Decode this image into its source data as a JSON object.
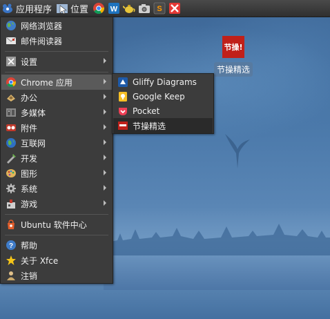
{
  "panel": {
    "apps_label": "应用程序",
    "places_label": "位置",
    "launchers": [
      "chrome-icon",
      "wps-writer-icon",
      "teapot-icon",
      "camera-icon",
      "sublime-text-icon",
      "xmind-icon"
    ]
  },
  "main_menu": {
    "items": [
      {
        "label": "网络浏览器",
        "icon": "web-browser-icon"
      },
      {
        "label": "邮件阅读器",
        "icon": "mail-reader-icon"
      },
      {
        "label": "设置",
        "icon": "settings-icon"
      },
      {
        "label": "Chrome 应用",
        "icon": "chrome-icon"
      },
      {
        "label": "办公",
        "icon": "office-icon"
      },
      {
        "label": "多媒体",
        "icon": "multimedia-icon"
      },
      {
        "label": "附件",
        "icon": "accessories-icon"
      },
      {
        "label": "互联网",
        "icon": "internet-icon"
      },
      {
        "label": "开发",
        "icon": "development-icon"
      },
      {
        "label": "图形",
        "icon": "graphics-icon"
      },
      {
        "label": "系统",
        "icon": "system-icon"
      },
      {
        "label": "游戏",
        "icon": "games-icon"
      },
      {
        "label": "Ubuntu 软件中心",
        "icon": "ubuntu-software-center-icon"
      },
      {
        "label": "帮助",
        "icon": "help-icon"
      },
      {
        "label": "关于 Xfce",
        "icon": "about-xfce-icon"
      },
      {
        "label": "注销",
        "icon": "logout-icon"
      }
    ]
  },
  "chrome_apps_menu": {
    "items": [
      {
        "label": "Gliffy Diagrams",
        "icon": "gliffy-icon"
      },
      {
        "label": "Google Keep",
        "icon": "google-keep-icon"
      },
      {
        "label": "Pocket",
        "icon": "pocket-icon"
      },
      {
        "label": "节操精选",
        "icon": "jiecao-icon"
      }
    ]
  },
  "desktop": {
    "icon_label": "节操精选",
    "icon_glyph_text": "节操!"
  },
  "colors": {
    "panel_bg": "#333333",
    "menu_bg": "#3c3c3c",
    "menu_active": "#5a5a5a",
    "submenu_active": "#2a2a2a",
    "desktop_blue": "#4b79aa"
  }
}
